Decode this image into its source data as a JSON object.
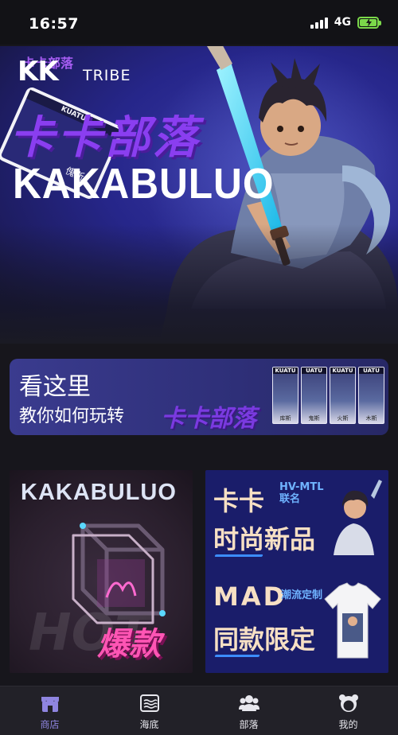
{
  "status_bar": {
    "time": "16:57",
    "network": "4G"
  },
  "banner": {
    "logo_kk": "KK",
    "logo_cn_small": "卡卡部落",
    "logo_tribe": "TRIBE",
    "title_cn": "卡卡部落",
    "title_en": "KAKABULUO",
    "card_label": "KUATU",
    "card_name": "傀斯"
  },
  "tutorial": {
    "line1": "看这里",
    "line2": "教你如何玩转",
    "brand": "卡卡部落",
    "mini_cards": [
      {
        "label": "KUATU",
        "name": "库斯"
      },
      {
        "label": "UATU",
        "name": "鬼斯"
      },
      {
        "label": "KUATU",
        "name": "火斯"
      },
      {
        "label": "UATU",
        "name": "木斯"
      }
    ]
  },
  "products": {
    "left": {
      "title": "KAKABULUO",
      "watermark": "HOT",
      "badge": "爆款"
    },
    "right": {
      "line1": "卡卡",
      "collab": "HV-MTL\n联名",
      "line2": "时尚新品",
      "line3": "MAD",
      "custom": "潮流定制",
      "line4": "同款限定"
    }
  },
  "bottom_nav": {
    "items": [
      {
        "label": "商店",
        "icon": "shop-icon",
        "active": true
      },
      {
        "label": "海底",
        "icon": "sea-icon",
        "active": false
      },
      {
        "label": "部落",
        "icon": "tribe-icon",
        "active": false
      },
      {
        "label": "我的",
        "icon": "profile-icon",
        "active": false
      }
    ]
  },
  "colors": {
    "accent": "#8f85e0",
    "background": "#17161c",
    "banner": "#26268a",
    "brand_purple": "#7a3ae0"
  }
}
